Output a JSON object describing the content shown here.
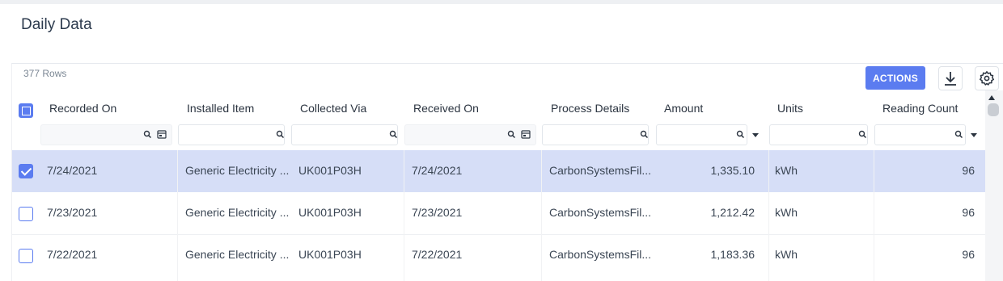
{
  "page": {
    "title": "Daily Data"
  },
  "toolbar": {
    "row_count": "377 Rows",
    "actions_label": "ACTIONS",
    "download_icon": "download-icon",
    "settings_icon": "gear-icon"
  },
  "colors": {
    "accent": "#5b7cf0",
    "selected_row": "#d6def7"
  },
  "table": {
    "columns": [
      "Recorded On",
      "Installed Item",
      "Collected Via",
      "Received On",
      "Process Details",
      "Amount",
      "Units",
      "Reading Count"
    ],
    "rows": [
      {
        "selected": true,
        "recorded_on": "7/24/2021",
        "installed_item": "Generic Electricity ...",
        "collected_via": "UK001P03H",
        "received_on": "7/24/2021",
        "process_details": "CarbonSystemsFil...",
        "amount": "1,335.10",
        "units": "kWh",
        "reading_count": "96"
      },
      {
        "selected": false,
        "recorded_on": "7/23/2021",
        "installed_item": "Generic Electricity ...",
        "collected_via": "UK001P03H",
        "received_on": "7/23/2021",
        "process_details": "CarbonSystemsFil...",
        "amount": "1,212.42",
        "units": "kWh",
        "reading_count": "96"
      },
      {
        "selected": false,
        "recorded_on": "7/22/2021",
        "installed_item": "Generic Electricity ...",
        "collected_via": "UK001P03H",
        "received_on": "7/22/2021",
        "process_details": "CarbonSystemsFil...",
        "amount": "1,183.36",
        "units": "kWh",
        "reading_count": "96"
      }
    ]
  }
}
